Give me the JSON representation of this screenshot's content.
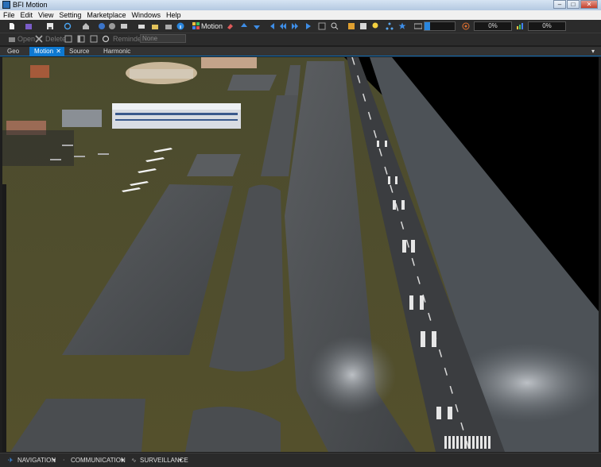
{
  "window": {
    "title": "BFI Motion"
  },
  "menu": [
    "File",
    "Edit",
    "View",
    "Setting",
    "Marketplace",
    "Windows",
    "Help"
  ],
  "toolbar": {
    "motion_label": "Motion",
    "progress_1": "0%",
    "progress_2": "0%"
  },
  "toolbar2": {
    "open_label": "Open",
    "delete_label": "Delete",
    "reminder_label": "Reminder",
    "reminder_value": "None"
  },
  "tabs": [
    "Geo",
    "Motion",
    "Source",
    "Harmonic"
  ],
  "active_tab": "Motion",
  "status": {
    "navigation": "NAVIGATION",
    "communication": "COMMUNICATION",
    "surveillance": "SURVEILLANCE"
  },
  "colors": {
    "accent": "#0e79d1",
    "grass": "#4f4a2a",
    "asphalt": "#3d3f42",
    "marking": "#e8e8e8"
  },
  "icons": [
    "new-icon",
    "open-icon",
    "save-icon",
    "refresh-icon",
    "grid-icon",
    "eraser-icon",
    "info-icon",
    "nav-arrow-icon",
    "star-icon",
    "lightbulb-icon",
    "settings-icon"
  ]
}
